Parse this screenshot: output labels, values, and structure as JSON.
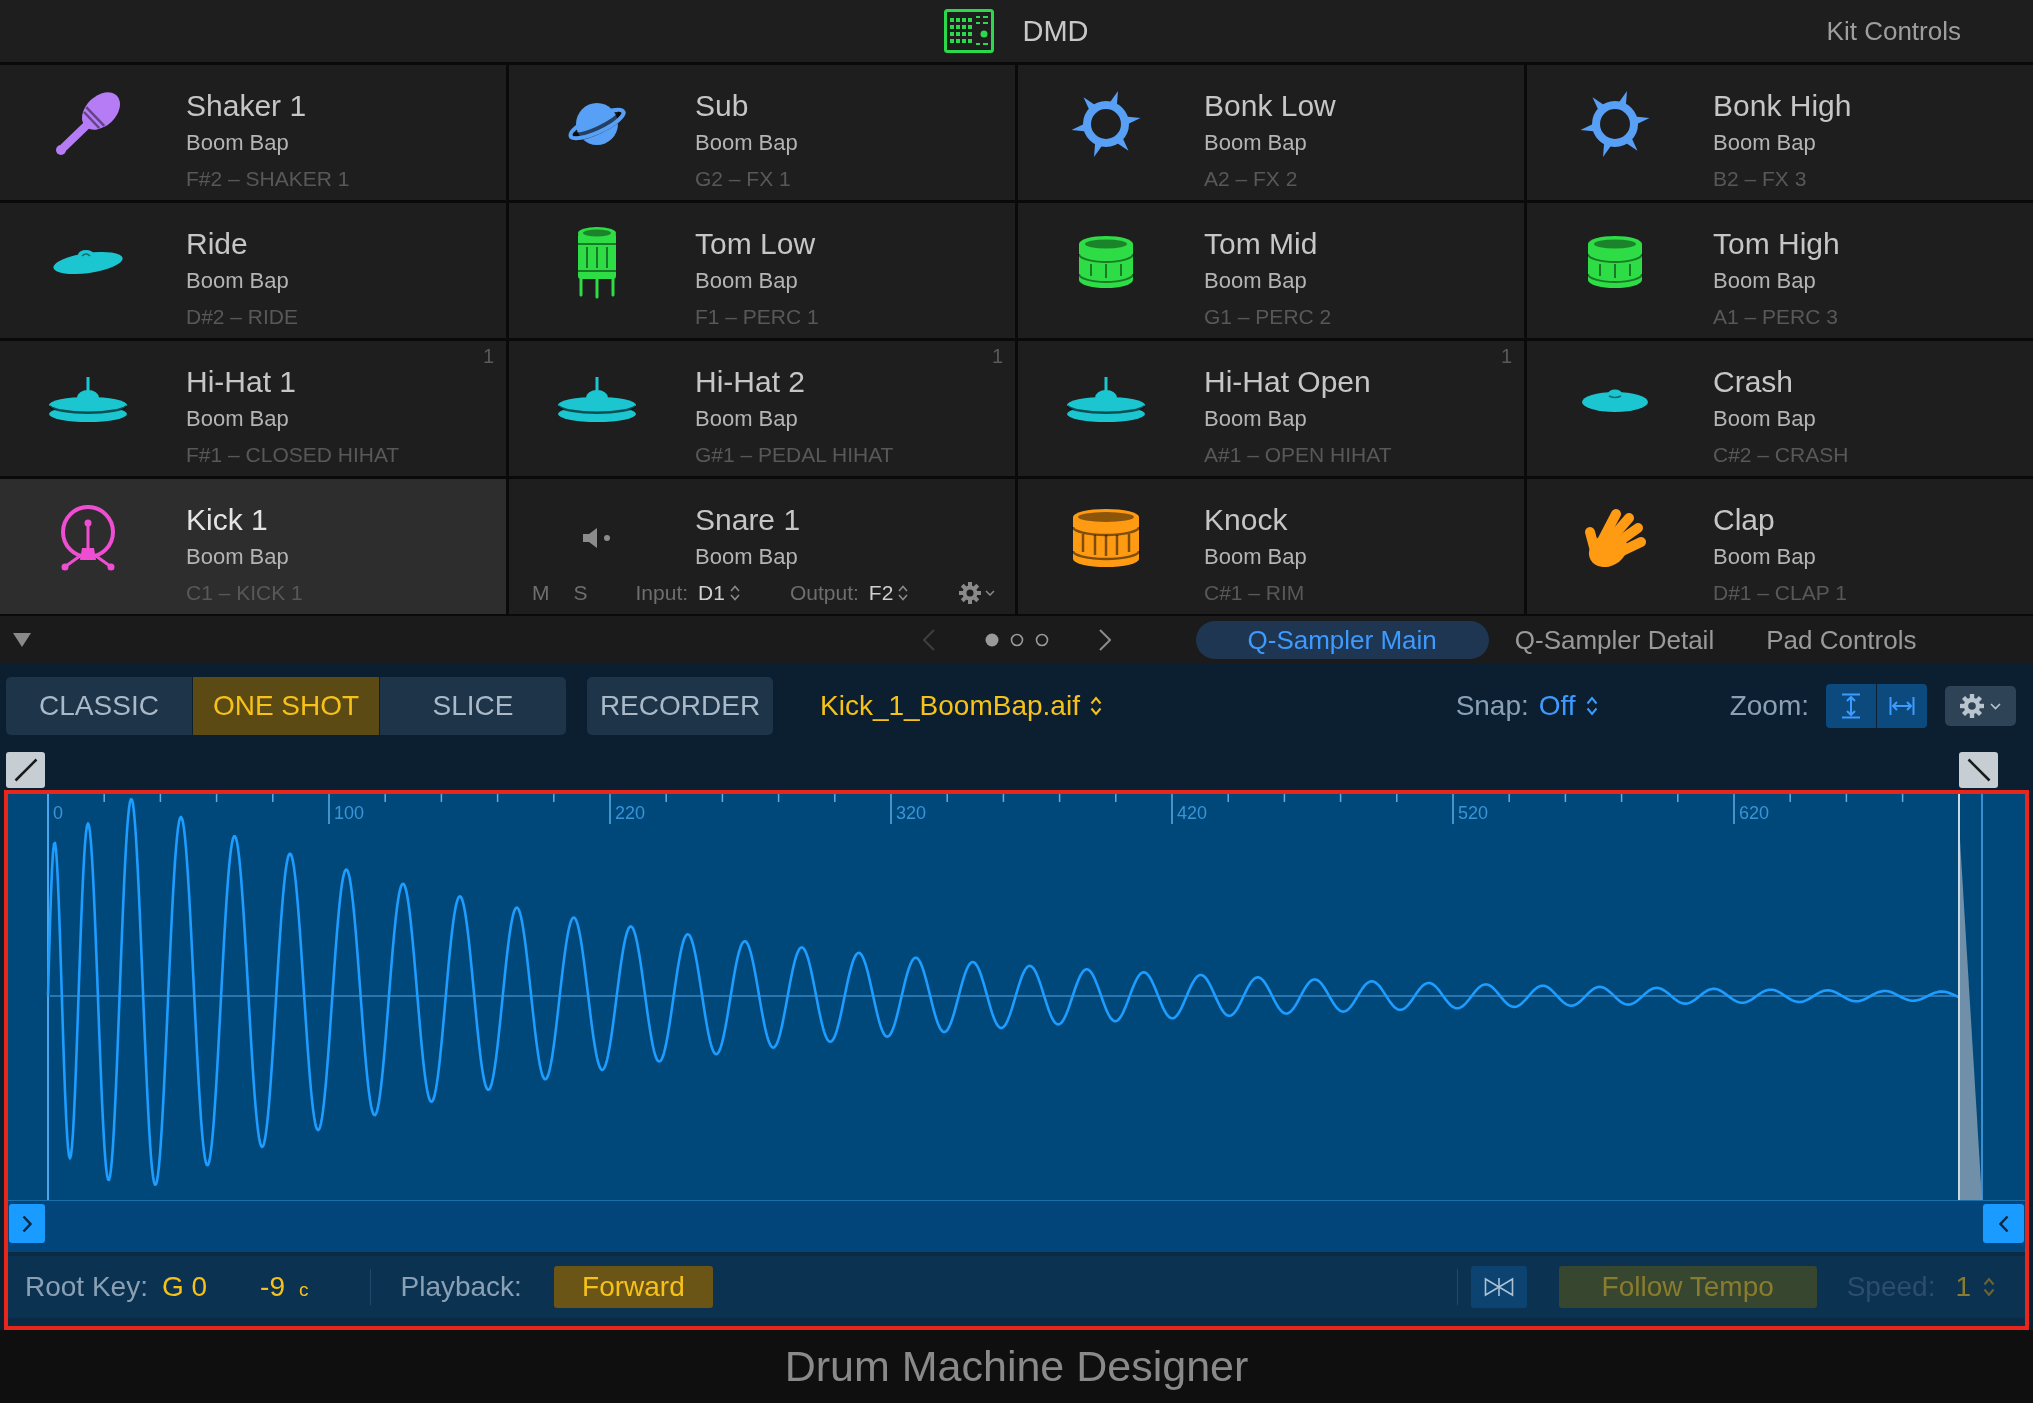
{
  "header": {
    "title": "DMD",
    "kit_controls": "Kit Controls"
  },
  "pads": [
    {
      "name": "Shaker 1",
      "kit": "Boom Bap",
      "note": "F#2 – SHAKER 1",
      "kind": "shaker",
      "color": "#b57cf5",
      "selected": false
    },
    {
      "name": "Sub",
      "kit": "Boom Bap",
      "note": "G2 – FX 1",
      "kind": "planet",
      "color": "#58a0f6",
      "selected": false
    },
    {
      "name": "Bonk Low",
      "kit": "Boom Bap",
      "note": "A2 – FX 2",
      "kind": "burst",
      "color": "#58a0f6",
      "selected": false
    },
    {
      "name": "Bonk High",
      "kit": "Boom Bap",
      "note": "B2 – FX 3",
      "kind": "burst",
      "color": "#58a0f6",
      "selected": false
    },
    {
      "name": "Ride",
      "kit": "Boom Bap",
      "note": "D#2 – RIDE",
      "kind": "ride",
      "color": "#1cc6d0",
      "selected": false
    },
    {
      "name": "Tom Low",
      "kit": "Boom Bap",
      "note": "F1 – PERC 1",
      "kind": "floortom",
      "color": "#2edc46",
      "selected": false
    },
    {
      "name": "Tom Mid",
      "kit": "Boom Bap",
      "note": "G1 – PERC 2",
      "kind": "tom",
      "color": "#2edc46",
      "selected": false
    },
    {
      "name": "Tom High",
      "kit": "Boom Bap",
      "note": "A1 – PERC 3",
      "kind": "tom",
      "color": "#2edc46",
      "selected": false
    },
    {
      "name": "Hi-Hat 1",
      "kit": "Boom Bap",
      "note": "F#1 – CLOSED HIHAT",
      "group": "1",
      "kind": "hihat",
      "color": "#1cc6d0",
      "selected": false
    },
    {
      "name": "Hi-Hat 2",
      "kit": "Boom Bap",
      "note": "G#1 – PEDAL HIHAT",
      "group": "1",
      "kind": "hihat",
      "color": "#1cc6d0",
      "selected": false
    },
    {
      "name": "Hi-Hat Open",
      "kit": "Boom Bap",
      "note": "A#1 – OPEN HIHAT",
      "group": "1",
      "kind": "hihat",
      "color": "#1cc6d0",
      "selected": false
    },
    {
      "name": "Crash",
      "kit": "Boom Bap",
      "note": "C#2 – CRASH",
      "kind": "crash",
      "color": "#1cc6d0",
      "selected": false
    },
    {
      "name": "Kick 1",
      "kit": "Boom Bap",
      "note": "C1 – KICK 1",
      "kind": "kick",
      "color": "#f04ed2",
      "selected": true
    },
    {
      "name": "Snare 1",
      "kit": "Boom Bap",
      "kind": "speaker",
      "color": "#8c8c8c",
      "selected": false,
      "controls": {
        "mute": "M",
        "solo": "S",
        "input_label": "Input:",
        "input": "D1",
        "output_label": "Output:",
        "output": "F2"
      }
    },
    {
      "name": "Knock",
      "kit": "Boom Bap",
      "note": "C#1 – RIM",
      "kind": "snare",
      "color": "#ff9b12",
      "selected": false
    },
    {
      "name": "Clap",
      "kit": "Boom Bap",
      "note": "D#1 – CLAP 1",
      "kind": "hand",
      "color": "#ff9b12",
      "selected": false
    }
  ],
  "tab_bar": {
    "pager": {
      "dots": [
        {
          "selected": true
        },
        {
          "selected": false
        },
        {
          "selected": false
        }
      ]
    },
    "tabs": [
      {
        "label": "Q-Sampler Main",
        "selected": true
      },
      {
        "label": "Q-Sampler Detail",
        "selected": false
      },
      {
        "label": "Pad Controls",
        "selected": false
      }
    ]
  },
  "sampler": {
    "modes": [
      {
        "label": "CLASSIC",
        "selected": false
      },
      {
        "label": "ONE SHOT",
        "selected": true
      },
      {
        "label": "SLICE",
        "selected": false
      }
    ],
    "recorder": "RECORDER",
    "file": "Kick_1_BoomBap.aif",
    "snap": {
      "label": "Snap:",
      "value": "Off"
    },
    "zoom": {
      "label": "Zoom:"
    },
    "waveform": {
      "highlighted": true,
      "ruler": [
        "0",
        "100",
        "220",
        "320",
        "420",
        "520",
        "620"
      ]
    },
    "root_key": {
      "label": "Root Key:",
      "value": "G 0",
      "fine": "-9",
      "unit": "c"
    },
    "playback": {
      "label": "Playback:",
      "value": "Forward"
    },
    "follow_tempo": {
      "label": "Follow Tempo",
      "disabled": true
    },
    "speed": {
      "label": "Speed:",
      "value": "1",
      "disabled": true
    }
  },
  "footer": "Drum Machine Designer"
}
